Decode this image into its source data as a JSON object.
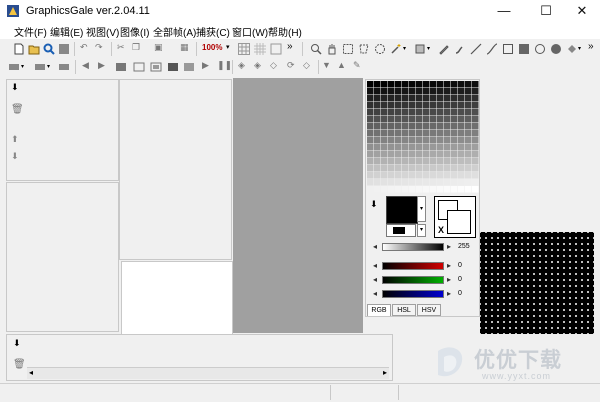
{
  "window": {
    "title": "GraphicsGale ver.2.04.11",
    "min_glyph": "—",
    "max_glyph": "☐",
    "close_glyph": "✕"
  },
  "menu": [
    {
      "label": "文件(F)"
    },
    {
      "label": "编辑(E)"
    },
    {
      "label": "视图(V)"
    },
    {
      "label": "图像(I)"
    },
    {
      "label": "全部帧(A)"
    },
    {
      "label": "捕获(C)"
    },
    {
      "label": "窗口(W)"
    },
    {
      "label": "帮助(H)"
    }
  ],
  "toolbar": {
    "zoom_value": "100%",
    "overflow_glyph": "»"
  },
  "color_panel": {
    "tabs": [
      "RGB",
      "HSL",
      "HSV"
    ],
    "gray_value": "255",
    "red_value": "0",
    "green_value": "0",
    "blue_value": "0",
    "transparent_label": "X",
    "colors": {
      "red": "#d00000",
      "green": "#00b000",
      "blue": "#0000d0"
    }
  },
  "watermark": {
    "brand": "优优下载",
    "url": "www.yyxt.com"
  }
}
